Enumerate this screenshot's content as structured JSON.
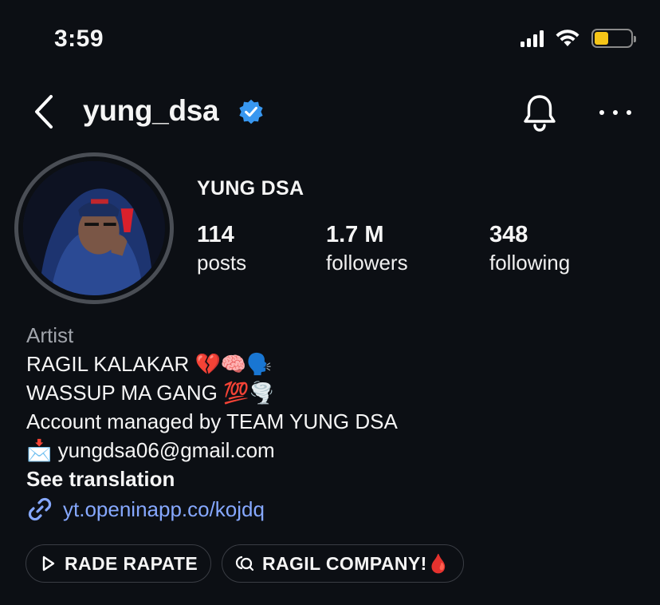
{
  "status_bar": {
    "time": "3:59",
    "battery_color": "#f5c518"
  },
  "header": {
    "username": "yung_dsa",
    "verified_color": "#3897f0",
    "back_icon": "chevron-left-icon",
    "notification_icon": "bell-icon",
    "more_icon": "more-horizontal-icon"
  },
  "profile": {
    "display_name": "YUNG DSA",
    "stats": [
      {
        "value": "114",
        "label": "posts"
      },
      {
        "value": "1.7 M",
        "label": "followers"
      },
      {
        "value": "348",
        "label": "following"
      }
    ]
  },
  "bio": {
    "category": "Artist",
    "lines": [
      "RAGIL KALAKAR 💔🧠🗣️",
      "WASSUP MA GANG 💯🌪️",
      "Account managed by TEAM YUNG DSA",
      "📩 yungdsa06@gmail.com"
    ],
    "see_translation": "See translation",
    "link": "yt.openinapp.co/kojdq",
    "link_color": "#86a8ff"
  },
  "highlights": [
    {
      "label": "RADE RAPATE",
      "icon": "play-icon"
    },
    {
      "label": "RAGIL COMPANY!🩸",
      "icon": "threads-icon"
    }
  ]
}
